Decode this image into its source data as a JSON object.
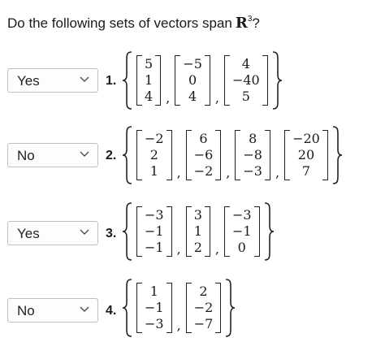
{
  "question": {
    "text": "Do the following sets of vectors span",
    "space": "R",
    "exponent": "3",
    "mark": "?"
  },
  "items": [
    {
      "answer": "Yes",
      "number": "1.",
      "vectors": [
        [
          "5",
          "1",
          "4"
        ],
        [
          "−5",
          "0",
          "4"
        ],
        [
          "4",
          "−40",
          "5"
        ]
      ]
    },
    {
      "answer": "No",
      "number": "2.",
      "vectors": [
        [
          "−2",
          "2",
          "1"
        ],
        [
          "6",
          "−6",
          "−2"
        ],
        [
          "8",
          "−8",
          "−3"
        ],
        [
          "−20",
          "20",
          "7"
        ]
      ]
    },
    {
      "answer": "Yes",
      "number": "3.",
      "vectors": [
        [
          "−3",
          "−1",
          "−1"
        ],
        [
          "3",
          "1",
          "2"
        ],
        [
          "−3",
          "−1",
          "0"
        ]
      ]
    },
    {
      "answer": "No",
      "number": "4.",
      "vectors": [
        [
          "1",
          "−1",
          "−3"
        ],
        [
          "2",
          "−2",
          "−7"
        ]
      ]
    }
  ],
  "icons": {
    "dropdown": "chevron-down-icon"
  },
  "colors": {
    "text": "#1a1a1a",
    "border": "#bfbfbf",
    "chevron": "#555555"
  }
}
